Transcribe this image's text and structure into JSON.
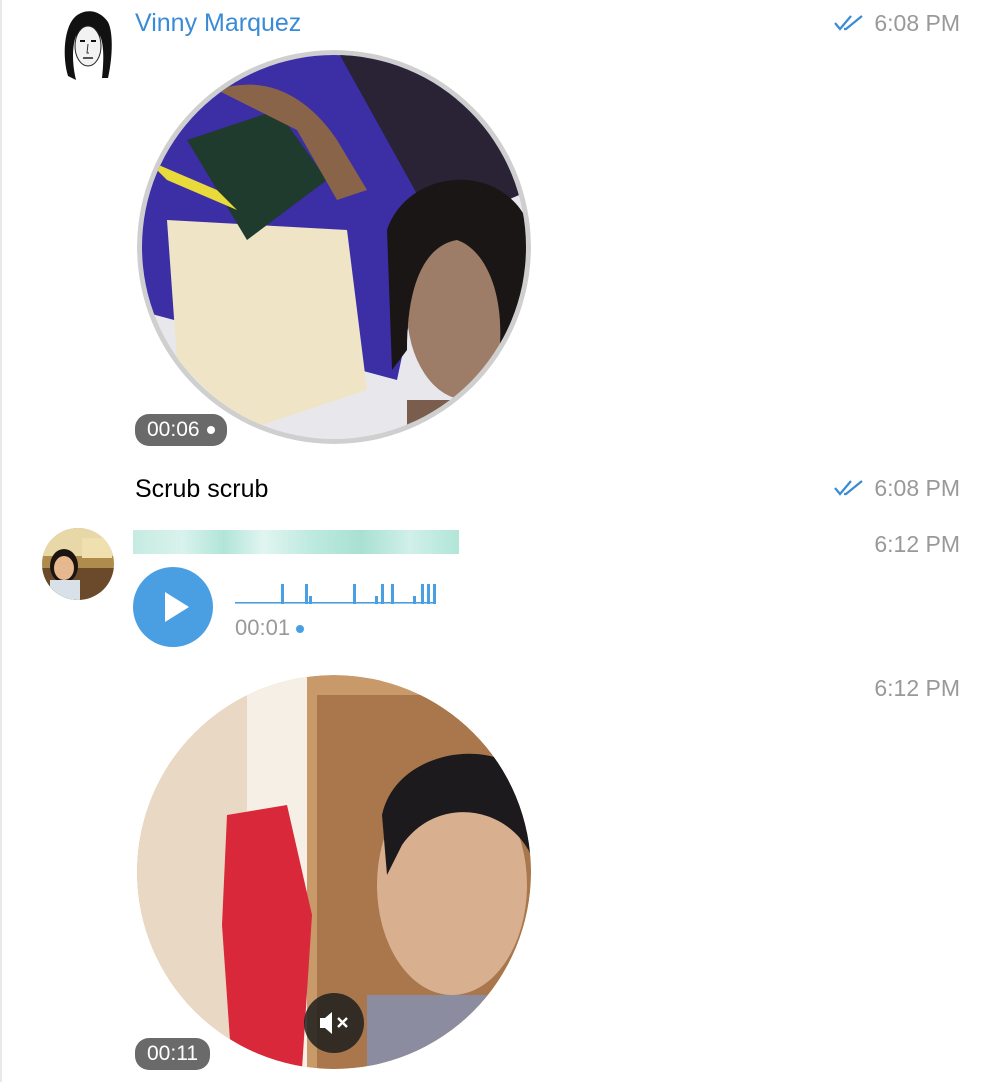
{
  "messages": [
    {
      "sender": "Vinny Marquez",
      "time": "6:08 PM",
      "status": "read",
      "type": "video-message",
      "duration": "00:06",
      "unplayed_dot": true
    },
    {
      "type": "text",
      "text": "Scrub scrub",
      "time": "6:08 PM",
      "status": "read"
    },
    {
      "type": "voice-message",
      "time": "6:12 PM",
      "duration": "00:01",
      "unplayed_dot": true
    },
    {
      "type": "video-message",
      "time": "6:12 PM",
      "duration": "00:11",
      "muted": true
    }
  ],
  "colors": {
    "accent": "#3a8bd6",
    "play_button": "#4a9fe3",
    "timestamp": "#999999",
    "badge_bg": "#505050"
  },
  "icons": {
    "read_receipt": "double-check-icon",
    "play": "play-icon",
    "mute": "speaker-muted-icon"
  }
}
